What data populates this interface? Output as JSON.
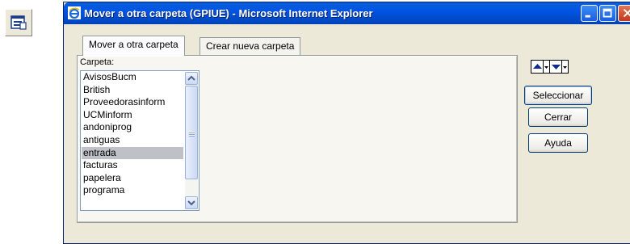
{
  "window": {
    "title": "Mover a otra carpeta (GPIUE) - Microsoft Internet Explorer"
  },
  "tabs": [
    {
      "label": "Mover a otra carpeta",
      "active": true
    },
    {
      "label": "Crear nueva carpeta",
      "active": false
    }
  ],
  "folder_list": {
    "label": "Carpeta:",
    "items": [
      "AvisosBucm",
      "British",
      "Proveedorasinform",
      "UCMinform",
      "andoniprog",
      "antiguas",
      "entrada",
      "facturas",
      "papelera",
      "programa"
    ],
    "selected": "entrada"
  },
  "buttons": {
    "select": "Seleccionar",
    "close": "Cerrar",
    "help": "Ayuda"
  },
  "colors": {
    "titlebar": "#0054e3",
    "selection": "#c0c0c8",
    "face": "#ece9d8"
  },
  "icons": [
    "toolbar-folder-icon",
    "ie-icon",
    "minimize-icon",
    "maximize-icon",
    "close-icon",
    "move-up-icon",
    "move-down-icon",
    "dropdown-arrow-icon",
    "scroll-up-icon",
    "scroll-down-icon"
  ]
}
